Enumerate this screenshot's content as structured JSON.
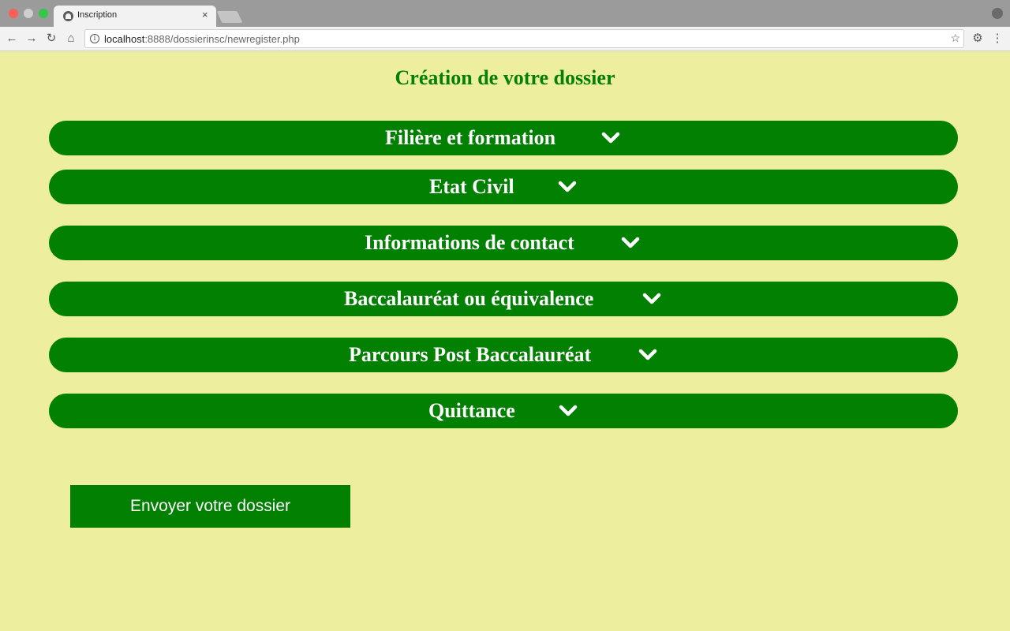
{
  "browser": {
    "tab_title": "Inscription",
    "tab_close": "×",
    "url_host": "localhost",
    "url_rest": ":8888/dossierinsc/newregister.php"
  },
  "page": {
    "title": "Création de votre dossier",
    "sections": [
      {
        "label": "Filière et formation"
      },
      {
        "label": "Etat Civil"
      },
      {
        "label": "Informations de contact"
      },
      {
        "label": "Baccalauréat ou équivalence"
      },
      {
        "label": "Parcours Post Baccalauréat"
      },
      {
        "label": "Quittance"
      }
    ],
    "submit_label": "Envoyer votre dossier"
  },
  "colors": {
    "background": "#eeee9f",
    "accent": "#018001"
  }
}
